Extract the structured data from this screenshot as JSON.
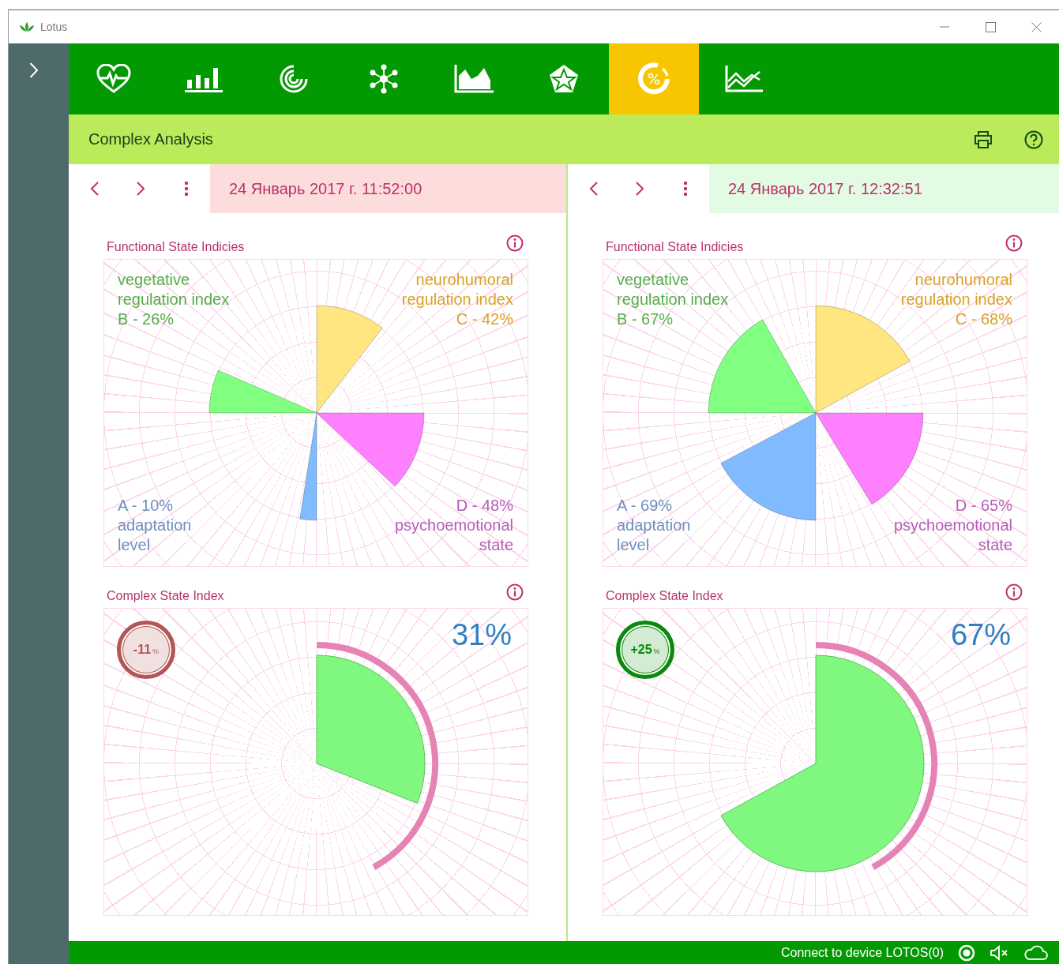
{
  "window": {
    "title": "Lotus"
  },
  "toolbar": {
    "tabs": [
      {
        "kind": "heart",
        "selected": false
      },
      {
        "kind": "bars",
        "selected": false
      },
      {
        "kind": "spiral",
        "selected": false
      },
      {
        "kind": "network",
        "selected": false
      },
      {
        "kind": "area",
        "selected": false
      },
      {
        "kind": "pentagon",
        "selected": false
      },
      {
        "kind": "percent",
        "selected": true
      },
      {
        "kind": "line",
        "selected": false
      }
    ]
  },
  "header": {
    "title": "Complex Analysis"
  },
  "panels": [
    {
      "date": {
        "text": "24 Январь 2017 г. 11:52:00",
        "color": "#fddcdc"
      },
      "functional": {
        "title": "Functional State Indicies",
        "indices": [
          {
            "name_lines": [
              "vegetative",
              "regulation index"
            ],
            "value": "B - 26%",
            "color": "#80ff80"
          },
          {
            "name_lines": [
              "neurohumoral",
              "regulation index"
            ],
            "value": "C - 42%",
            "color": "#ffe680"
          },
          {
            "name_lines": [
              "adaptation",
              "level"
            ],
            "value": "A - 10%",
            "color": "#80bbff"
          },
          {
            "name_lines": [
              "psychoemotional",
              "state"
            ],
            "value": "D - 48%",
            "color": "#ff80ff"
          }
        ]
      },
      "complex": {
        "title": "Complex State Index",
        "value": "31%",
        "change": "-11",
        "change_unit": "%",
        "color": "#b25555"
      }
    },
    {
      "date": {
        "text": "24 Январь 2017 г. 12:32:51",
        "color": "#e3fbe3"
      },
      "functional": {
        "title": "Functional State Indicies",
        "indices": [
          {
            "name_lines": [
              "vegetative",
              "regulation index"
            ],
            "value": "B - 67%",
            "color": "#80ff80"
          },
          {
            "name_lines": [
              "neurohumoral",
              "regulation index"
            ],
            "value": "C - 68%",
            "color": "#ffe680"
          },
          {
            "name_lines": [
              "adaptation",
              "level"
            ],
            "value": "A - 69%",
            "color": "#80bbff"
          },
          {
            "name_lines": [
              "psychoemotional",
              "state"
            ],
            "value": "D - 65%",
            "color": "#ff80ff"
          }
        ]
      },
      "complex": {
        "title": "Complex State Index",
        "value": "67%",
        "change": "+25",
        "change_unit": "%",
        "color": "#0a8a0a"
      }
    }
  ],
  "status_bar": {
    "text": "Connect to device LOTOS(0)"
  }
}
